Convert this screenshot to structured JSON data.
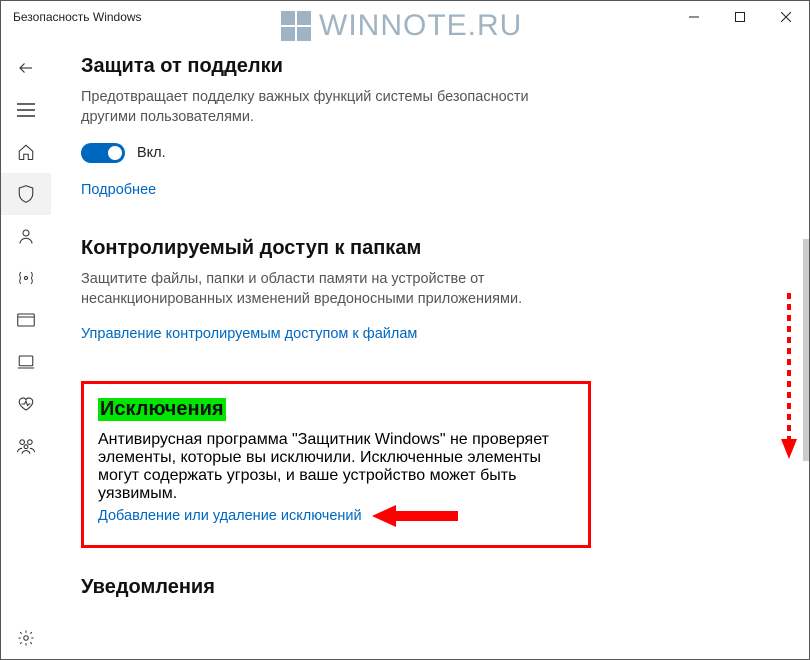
{
  "window": {
    "title": "Безопасность Windows"
  },
  "watermark": "WINNOTE.RU",
  "sections": {
    "tamper": {
      "heading": "Защита от подделки",
      "desc": "Предотвращает подделку важных функций системы безопасности другими пользователями.",
      "toggle_state": "Вкл.",
      "more": "Подробнее"
    },
    "folder": {
      "heading": "Контролируемый доступ к папкам",
      "desc": "Защитите файлы, папки и области памяти на устройстве от несанкционированных изменений вредоносными приложениями.",
      "link": "Управление контролируемым доступом к файлам"
    },
    "excl": {
      "heading": "Исключения",
      "desc": "Антивирусная программа \"Защитник Windows\" не проверяет элементы, которые вы исключили. Исключенные элементы могут содержать угрозы, и ваше устройство может быть уязвимым.",
      "link": "Добавление или удаление исключений"
    },
    "notif": {
      "heading": "Уведомления"
    }
  }
}
